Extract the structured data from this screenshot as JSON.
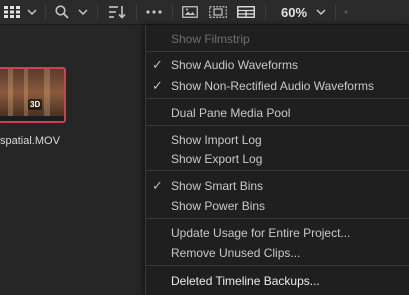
{
  "toolbar": {
    "icons": [
      "grid-view-icon",
      "chevron-down-icon",
      "search-icon",
      "chevron-down-icon",
      "sort-icon",
      "more-options-icon",
      "clip-view-icon",
      "filmstrip-view-icon",
      "list-view-icon",
      "chevron-down-icon"
    ],
    "zoom_label": "60%"
  },
  "media_pool": {
    "clip": {
      "name": "spatial.MOV",
      "badge": "3D",
      "border_color": "#c8434f"
    }
  },
  "menu": {
    "items": [
      {
        "label": "Show Filmstrip",
        "checked": false,
        "enabled": false
      },
      {
        "label": "Show Audio Waveforms",
        "checked": true,
        "enabled": true
      },
      {
        "label": "Show Non-Rectified Audio Waveforms",
        "checked": true,
        "enabled": true
      },
      {
        "label": "Dual Pane Media Pool",
        "checked": false,
        "enabled": true
      },
      {
        "label": "Show Import Log",
        "checked": false,
        "enabled": true
      },
      {
        "label": "Show Export Log",
        "checked": false,
        "enabled": true
      },
      {
        "label": "Show Smart Bins",
        "checked": true,
        "enabled": true
      },
      {
        "label": "Show Power Bins",
        "checked": false,
        "enabled": true
      },
      {
        "label": "Update Usage for Entire Project...",
        "checked": false,
        "enabled": true
      },
      {
        "label": "Remove Unused Clips...",
        "checked": false,
        "enabled": true
      },
      {
        "label": "Deleted Timeline Backups...",
        "checked": false,
        "enabled": true,
        "highlighted": true
      }
    ]
  }
}
